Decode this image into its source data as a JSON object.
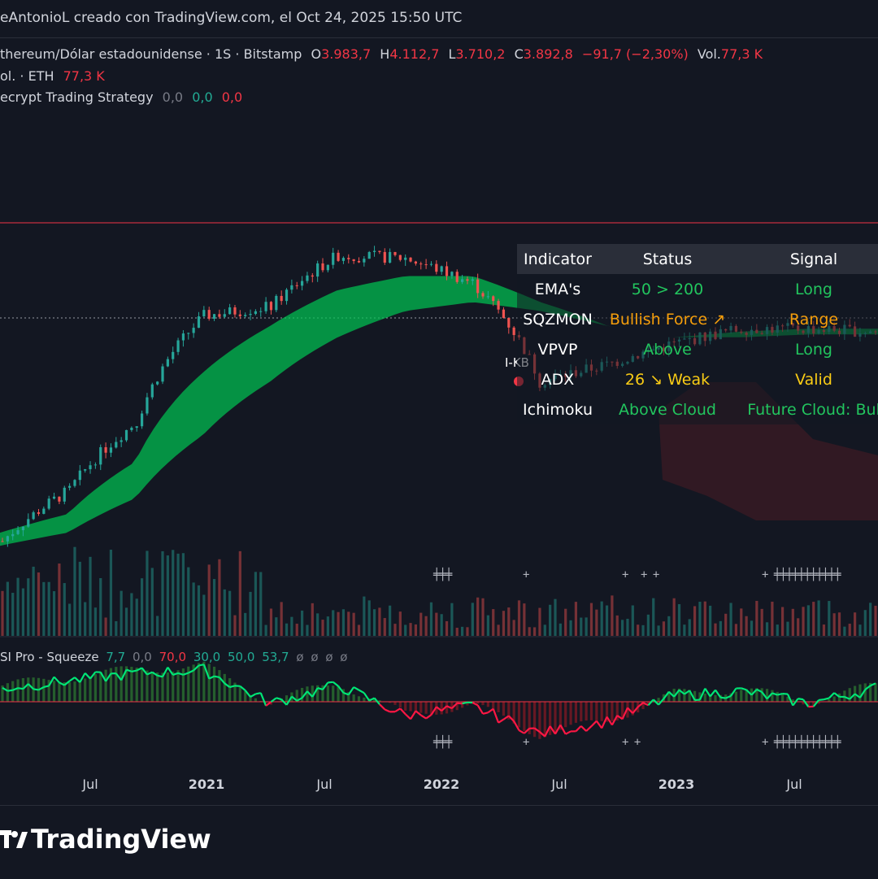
{
  "header": {
    "text": "eAntonioL creado con TradingView.com, el Oct 24, 2025 15:50 UTC"
  },
  "legend": {
    "symbol": "thereum/Dólar estadounidense · 1S · Bitstamp",
    "o_label": "O",
    "o_value": "3.983,7",
    "h_label": "H",
    "h_value": "4.112,7",
    "l_label": "L",
    "l_value": "3.710,2",
    "c_label": "C",
    "c_value": "3.892,8",
    "change": "−91,7 (−2,30%)",
    "vol_label": "Vol.",
    "vol_value": "77,3 K",
    "vol_row_label": "ol. · ETH",
    "vol_row_value": "77,3 K",
    "strategy_label": "ecrypt Trading Strategy",
    "strategy_v1": "0,0",
    "strategy_v2": "0,0",
    "strategy_v3": "0,0"
  },
  "status_table": {
    "headers": [
      "Indicator",
      "Status",
      "Signal"
    ],
    "rows": [
      {
        "indicator": "EMA's",
        "status": "50 > 200",
        "signal": "Long",
        "status_color": "#22c55e",
        "signal_color": "#22c55e"
      },
      {
        "indicator": "SQZMON",
        "status": "Bullish Force ↗",
        "signal": "Range",
        "status_color": "#f59e0b",
        "signal_color": "#f59e0b"
      },
      {
        "indicator": "VPVP",
        "status": "Above",
        "signal": "Long",
        "status_color": "#22c55e",
        "signal_color": "#22c55e"
      },
      {
        "indicator": "ADX",
        "status": "26 ↘ Weak",
        "signal": "Valid",
        "status_color": "#facc15",
        "signal_color": "#facc15"
      },
      {
        "indicator": "Ichimoku",
        "status": "Above Cloud",
        "signal": "Future Cloud: Bul",
        "status_color": "#22c55e",
        "signal_color": "#22c55e"
      }
    ]
  },
  "kb_label": "I-KB",
  "oscillator": {
    "label": "SI Pro - Squeeze",
    "values": [
      "7,7",
      "0,0",
      "70,0",
      "30,0",
      "50,0",
      "53,7",
      "ø",
      "ø",
      "ø",
      "ø"
    ]
  },
  "x_axis": {
    "ticks": [
      {
        "label": "Jul",
        "year": false
      },
      {
        "label": "2021",
        "year": true
      },
      {
        "label": "Jul",
        "year": false
      },
      {
        "label": "2022",
        "year": true
      },
      {
        "label": "Jul",
        "year": false
      },
      {
        "label": "2023",
        "year": true
      },
      {
        "label": "Jul",
        "year": false
      }
    ]
  },
  "crosses": {
    "top": [
      "╪╪╪",
      "+",
      "+",
      "+ +",
      "+ ╪╪╪╪╪╪╪╪╪╪╪"
    ],
    "bottom": [
      "╪╪╪",
      "+",
      "+ +",
      "+ ╪╪╪╪╪╪╪╪╪╪╪"
    ]
  },
  "footer": {
    "logo_text": "TradingView",
    "logo_icon": "tradingview-logo-icon"
  },
  "colors": {
    "background": "#131722",
    "up": "#26a69a",
    "down": "#ef5350",
    "cloud": "#00c853",
    "red_line": "#f23645",
    "rsi_up": "#00e676",
    "rsi_down": "#ff1744"
  },
  "chart_data": {
    "type": "candlestick",
    "title": "Ethereum/Dólar estadounidense · 1S · Bitstamp",
    "x": [
      "2020-07",
      "2020-10",
      "2021-01",
      "2021-04",
      "2021-07",
      "2021-10",
      "2022-01",
      "2022-04",
      "2022-07",
      "2022-10",
      "2023-01",
      "2023-04",
      "2023-07",
      "2023-10"
    ],
    "close_approx": [
      230,
      380,
      740,
      2100,
      2300,
      3800,
      3700,
      2900,
      1100,
      1300,
      1600,
      1850,
      1850,
      1800
    ],
    "ema_cloud_upper_approx": [
      250,
      300,
      500,
      1200,
      1900,
      2700,
      3100,
      3100,
      2400,
      1900,
      1700,
      1800,
      1850,
      1850
    ],
    "ema_cloud_lower_approx": [
      220,
      250,
      350,
      650,
      1100,
      1700,
      2200,
      2400,
      2200,
      1900,
      1700,
      1700,
      1750,
      1750
    ],
    "rsi_approx": [
      60,
      65,
      70,
      72,
      50,
      62,
      42,
      48,
      30,
      38,
      55,
      58,
      50,
      60
    ],
    "rsi_midline": 50
  }
}
